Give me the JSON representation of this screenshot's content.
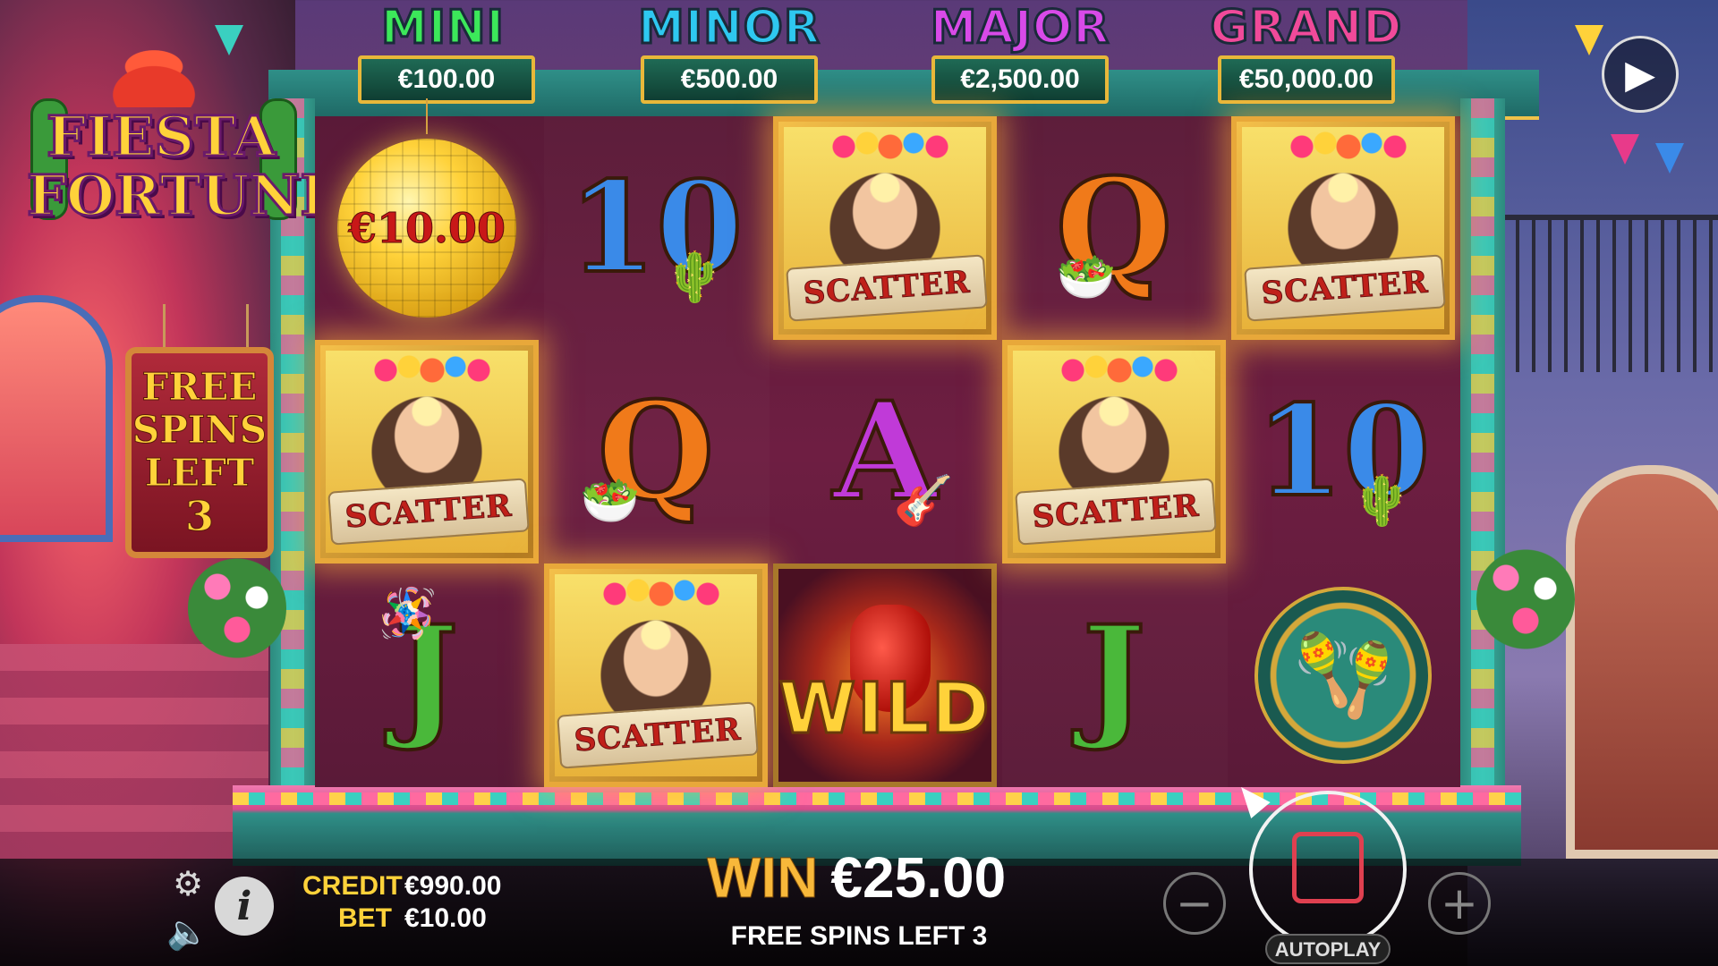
{
  "game": {
    "logo_line1": "FIESTA",
    "logo_line2": "FORTUNE"
  },
  "jackpots": [
    {
      "name": "MINI",
      "value": "€100.00",
      "color": "#3ce85a"
    },
    {
      "name": "MINOR",
      "value": "€500.00",
      "color": "#2ec8f0"
    },
    {
      "name": "MAJOR",
      "value": "€2,500.00",
      "color": "#d84ae8"
    },
    {
      "name": "GRAND",
      "value": "€50,000.00",
      "color": "#f04a9a"
    }
  ],
  "free_spins_sign": {
    "line1": "FREE",
    "line2": "SPINS",
    "line3": "LEFT",
    "count": "3"
  },
  "reels": {
    "reel1": {
      "row1_value": "€10.00",
      "row1_symbol": "gold-disco-ball",
      "row2_symbol": "scatter",
      "row3_symbol": "J"
    },
    "reel2": {
      "row1_symbol": "10",
      "row2_symbol": "Q",
      "row3_symbol": "scatter"
    },
    "reel3": {
      "row1_symbol": "scatter",
      "row2_symbol": "A",
      "row3_symbol": "wild"
    },
    "reel4": {
      "row1_symbol": "Q",
      "row2_symbol": "scatter",
      "row3_symbol": "J"
    },
    "reel5": {
      "row1_symbol": "scatter",
      "row2_symbol": "10",
      "row3_symbol": "maracas"
    },
    "scatter_label": "SCATTER",
    "wild_label": "WILD",
    "letters": {
      "ten": "10",
      "queen": "Q",
      "ace": "A",
      "jack": "J"
    }
  },
  "bottom_bar": {
    "credit_label": "CREDIT",
    "credit_value": "€990.00",
    "bet_label": "BET",
    "bet_value": "€10.00",
    "win_label": "WIN",
    "win_value": "€25.00",
    "free_spins_left": "FREE SPINS LEFT 3",
    "minus_label": "−",
    "plus_label": "+",
    "autoplay_label": "AUTOPLAY",
    "info_label": "i"
  },
  "icons": {
    "settings": "gear-icon",
    "sound": "speaker-icon",
    "replay": "replay-icon",
    "stop": "stop-icon",
    "info": "info-icon"
  }
}
